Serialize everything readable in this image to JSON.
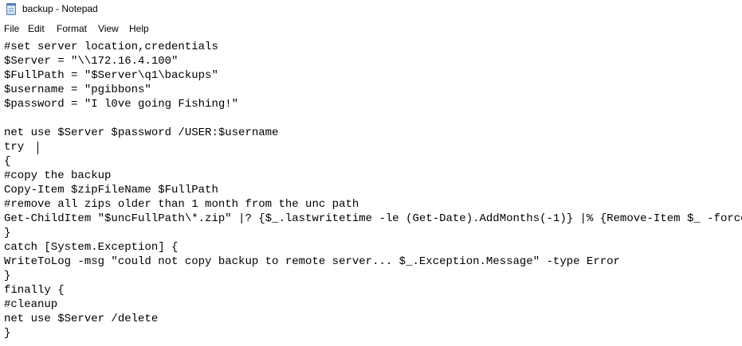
{
  "window": {
    "title": "backup - Notepad",
    "app_icon": "notepad-icon"
  },
  "menubar": {
    "items": [
      "File",
      "Edit",
      "Format",
      "View",
      "Help"
    ]
  },
  "editor": {
    "lines": [
      "#set server location,credentials",
      "$Server = \"\\\\172.16.4.100\"",
      "$FullPath = \"$Server\\q1\\backups\"",
      "$username = \"pgibbons\"",
      "$password = \"I l0ve going Fishing!\"",
      "",
      "net use $Server $password /USER:$username",
      "try ",
      "{",
      "#copy the backup",
      "Copy-Item $zipFileName $FullPath",
      "#remove all zips older than 1 month from the unc path",
      "Get-ChildItem \"$uncFullPath\\*.zip\" |? {$_.lastwritetime -le (Get-Date).AddMonths(-1)} |% {Remove-Item $_ -force }",
      "}",
      "catch [System.Exception] {",
      "WriteToLog -msg \"could not copy backup to remote server... $_.Exception.Message\" -type Error",
      "}",
      "finally {",
      "#cleanup",
      "net use $Server /delete",
      "}"
    ]
  }
}
